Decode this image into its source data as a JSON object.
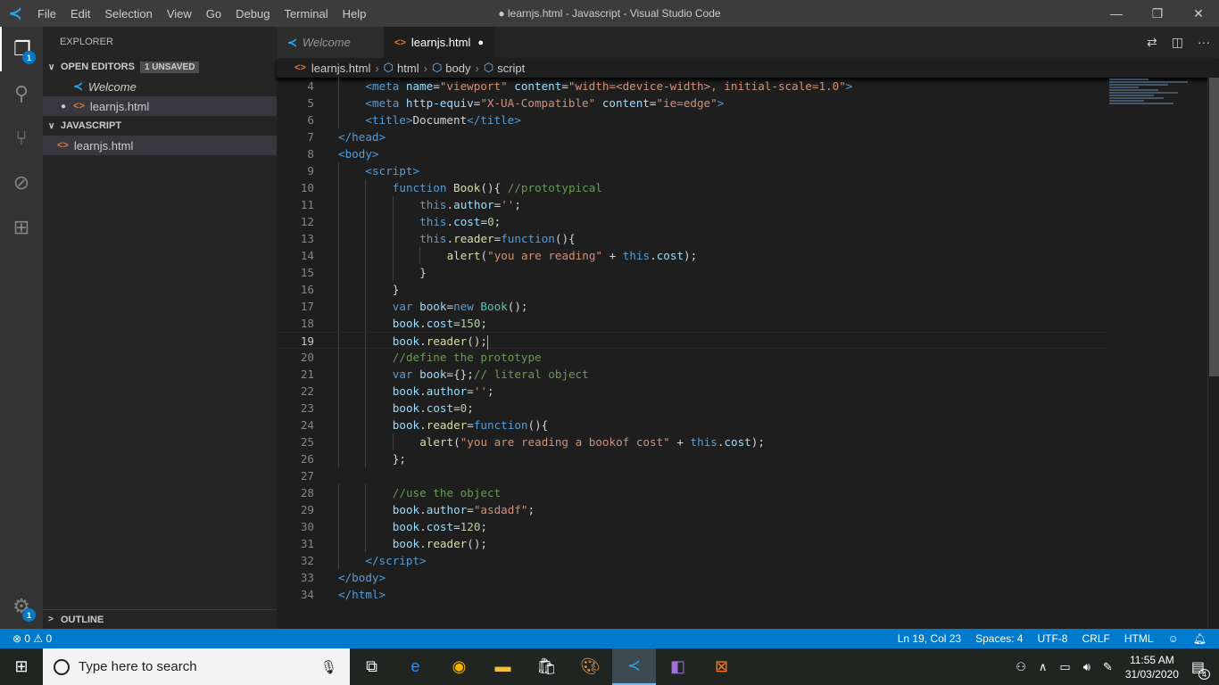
{
  "window": {
    "title": "● learnjs.html - Javascript - Visual Studio Code",
    "menu": [
      "File",
      "Edit",
      "Selection",
      "View",
      "Go",
      "Debug",
      "Terminal",
      "Help"
    ]
  },
  "activity": {
    "explorer_badge": "1",
    "settings_badge": "1"
  },
  "sidebar": {
    "title": "EXPLORER",
    "open_editors": "OPEN EDITORS",
    "unsaved": "1 UNSAVED",
    "open_items": [
      "Welcome",
      "learnjs.html"
    ],
    "folder": "JAVASCRIPT",
    "files": [
      "learnjs.html"
    ],
    "outline": "OUTLINE"
  },
  "tabs": [
    {
      "label": "Welcome"
    },
    {
      "label": "learnjs.html",
      "dirty": "●"
    }
  ],
  "breadcrumb": [
    "learnjs.html",
    "html",
    "body",
    "script"
  ],
  "editor": {
    "current_line": 19,
    "lines": [
      {
        "n": "4",
        "i": 4,
        "t": [
          [
            "tag",
            "<meta "
          ],
          [
            "att",
            "name"
          ],
          [
            "tx",
            "="
          ],
          [
            "str",
            "\"viewport\""
          ],
          [
            "tx",
            " "
          ],
          [
            "att",
            "content"
          ],
          [
            "tx",
            "="
          ],
          [
            "str",
            "\"width=<device-width>, initial-scale=1.0\""
          ],
          [
            "tag",
            ">"
          ]
        ]
      },
      {
        "n": "5",
        "i": 4,
        "t": [
          [
            "tag",
            "<meta "
          ],
          [
            "att",
            "http-equiv"
          ],
          [
            "tx",
            "="
          ],
          [
            "str",
            "\"X-UA-Compatible\""
          ],
          [
            "tx",
            " "
          ],
          [
            "att",
            "content"
          ],
          [
            "tx",
            "="
          ],
          [
            "str",
            "\"ie=edge\""
          ],
          [
            "tag",
            ">"
          ]
        ]
      },
      {
        "n": "6",
        "i": 4,
        "t": [
          [
            "tag",
            "<title>"
          ],
          [
            "tx",
            "Document"
          ],
          [
            "tag",
            "</title>"
          ]
        ]
      },
      {
        "n": "7",
        "i": 0,
        "t": [
          [
            "tag",
            "</head>"
          ]
        ]
      },
      {
        "n": "8",
        "i": 0,
        "t": [
          [
            "tag",
            "<body>"
          ]
        ]
      },
      {
        "n": "9",
        "i": 4,
        "t": [
          [
            "tag",
            "<script>"
          ]
        ]
      },
      {
        "n": "10",
        "i": 8,
        "t": [
          [
            "kw",
            "function "
          ],
          [
            "fn",
            "Book"
          ],
          [
            "tx",
            "(){ "
          ],
          [
            "cm",
            "//prototypical"
          ]
        ]
      },
      {
        "n": "11",
        "i": 12,
        "t": [
          [
            "kw",
            "this"
          ],
          [
            "tx",
            "."
          ],
          [
            "var",
            "author"
          ],
          [
            "tx",
            "="
          ],
          [
            "str",
            "''"
          ],
          [
            "tx",
            ";"
          ]
        ]
      },
      {
        "n": "12",
        "i": 12,
        "t": [
          [
            "kw",
            "this"
          ],
          [
            "tx",
            "."
          ],
          [
            "var",
            "cost"
          ],
          [
            "tx",
            "="
          ],
          [
            "num",
            "0"
          ],
          [
            "tx",
            ";"
          ]
        ]
      },
      {
        "n": "13",
        "i": 12,
        "t": [
          [
            "kw",
            "this"
          ],
          [
            "tx",
            "."
          ],
          [
            "fn",
            "reader"
          ],
          [
            "tx",
            "="
          ],
          [
            "kw",
            "function"
          ],
          [
            "tx",
            "(){"
          ]
        ]
      },
      {
        "n": "14",
        "i": 16,
        "t": [
          [
            "fn",
            "alert"
          ],
          [
            "tx",
            "("
          ],
          [
            "str",
            "\"you are reading\""
          ],
          [
            "tx",
            " + "
          ],
          [
            "kw",
            "this"
          ],
          [
            "tx",
            "."
          ],
          [
            "var",
            "cost"
          ],
          [
            "tx",
            ");"
          ]
        ]
      },
      {
        "n": "15",
        "i": 12,
        "t": [
          [
            "tx",
            "}"
          ]
        ]
      },
      {
        "n": "16",
        "i": 8,
        "t": [
          [
            "tx",
            "}"
          ]
        ]
      },
      {
        "n": "17",
        "i": 8,
        "t": [
          [
            "kw",
            "var "
          ],
          [
            "var",
            "book"
          ],
          [
            "tx",
            "="
          ],
          [
            "kw",
            "new "
          ],
          [
            "cls",
            "Book"
          ],
          [
            "tx",
            "();"
          ]
        ]
      },
      {
        "n": "18",
        "i": 8,
        "t": [
          [
            "var",
            "book"
          ],
          [
            "tx",
            "."
          ],
          [
            "var",
            "cost"
          ],
          [
            "tx",
            "="
          ],
          [
            "num",
            "150"
          ],
          [
            "tx",
            ";"
          ]
        ]
      },
      {
        "n": "19",
        "i": 8,
        "t": [
          [
            "var",
            "book"
          ],
          [
            "tx",
            "."
          ],
          [
            "fn",
            "reader"
          ],
          [
            "tx",
            "();"
          ]
        ]
      },
      {
        "n": "20",
        "i": 8,
        "t": [
          [
            "cm",
            "//define the prototype"
          ]
        ]
      },
      {
        "n": "21",
        "i": 8,
        "t": [
          [
            "kw",
            "var "
          ],
          [
            "var",
            "book"
          ],
          [
            "tx",
            "={};"
          ],
          [
            "cm",
            "// literal object"
          ]
        ]
      },
      {
        "n": "22",
        "i": 8,
        "t": [
          [
            "var",
            "book"
          ],
          [
            "tx",
            "."
          ],
          [
            "var",
            "author"
          ],
          [
            "tx",
            "="
          ],
          [
            "str",
            "''"
          ],
          [
            "tx",
            ";"
          ]
        ]
      },
      {
        "n": "23",
        "i": 8,
        "t": [
          [
            "var",
            "book"
          ],
          [
            "tx",
            "."
          ],
          [
            "var",
            "cost"
          ],
          [
            "tx",
            "="
          ],
          [
            "num",
            "0"
          ],
          [
            "tx",
            ";"
          ]
        ]
      },
      {
        "n": "24",
        "i": 8,
        "t": [
          [
            "var",
            "book"
          ],
          [
            "tx",
            "."
          ],
          [
            "fn",
            "reader"
          ],
          [
            "tx",
            "="
          ],
          [
            "kw",
            "function"
          ],
          [
            "tx",
            "(){"
          ]
        ]
      },
      {
        "n": "25",
        "i": 12,
        "t": [
          [
            "fn",
            "alert"
          ],
          [
            "tx",
            "("
          ],
          [
            "str",
            "\"you are reading a bookof cost\""
          ],
          [
            "tx",
            " + "
          ],
          [
            "kw",
            "this"
          ],
          [
            "tx",
            "."
          ],
          [
            "var",
            "cost"
          ],
          [
            "tx",
            ");"
          ]
        ]
      },
      {
        "n": "26",
        "i": 8,
        "t": [
          [
            "tx",
            "};"
          ]
        ]
      },
      {
        "n": "27",
        "i": 0,
        "t": []
      },
      {
        "n": "28",
        "i": 8,
        "t": [
          [
            "cm",
            "//use the object"
          ]
        ]
      },
      {
        "n": "29",
        "i": 8,
        "t": [
          [
            "var",
            "book"
          ],
          [
            "tx",
            "."
          ],
          [
            "var",
            "author"
          ],
          [
            "tx",
            "="
          ],
          [
            "str",
            "\"asdadf\""
          ],
          [
            "tx",
            ";"
          ]
        ]
      },
      {
        "n": "30",
        "i": 8,
        "t": [
          [
            "var",
            "book"
          ],
          [
            "tx",
            "."
          ],
          [
            "var",
            "cost"
          ],
          [
            "tx",
            "="
          ],
          [
            "num",
            "120"
          ],
          [
            "tx",
            ";"
          ]
        ]
      },
      {
        "n": "31",
        "i": 8,
        "t": [
          [
            "var",
            "book"
          ],
          [
            "tx",
            "."
          ],
          [
            "fn",
            "reader"
          ],
          [
            "tx",
            "();"
          ]
        ]
      },
      {
        "n": "32",
        "i": 4,
        "t": [
          [
            "tag",
            "</script>"
          ]
        ]
      },
      {
        "n": "33",
        "i": 0,
        "t": [
          [
            "tag",
            "</body>"
          ]
        ]
      },
      {
        "n": "34",
        "i": 0,
        "t": [
          [
            "tag",
            "</html>"
          ]
        ]
      }
    ]
  },
  "status": {
    "errors": "⊗ 0",
    "warnings": "⚠ 0",
    "position": "Ln 19, Col 23",
    "spaces": "Spaces: 4",
    "encoding": "UTF-8",
    "eol": "CRLF",
    "language": "HTML"
  },
  "taskbar": {
    "search_placeholder": "Type here to search",
    "time": "11:55 AM",
    "date": "31/03/2020",
    "notifications": "4"
  }
}
